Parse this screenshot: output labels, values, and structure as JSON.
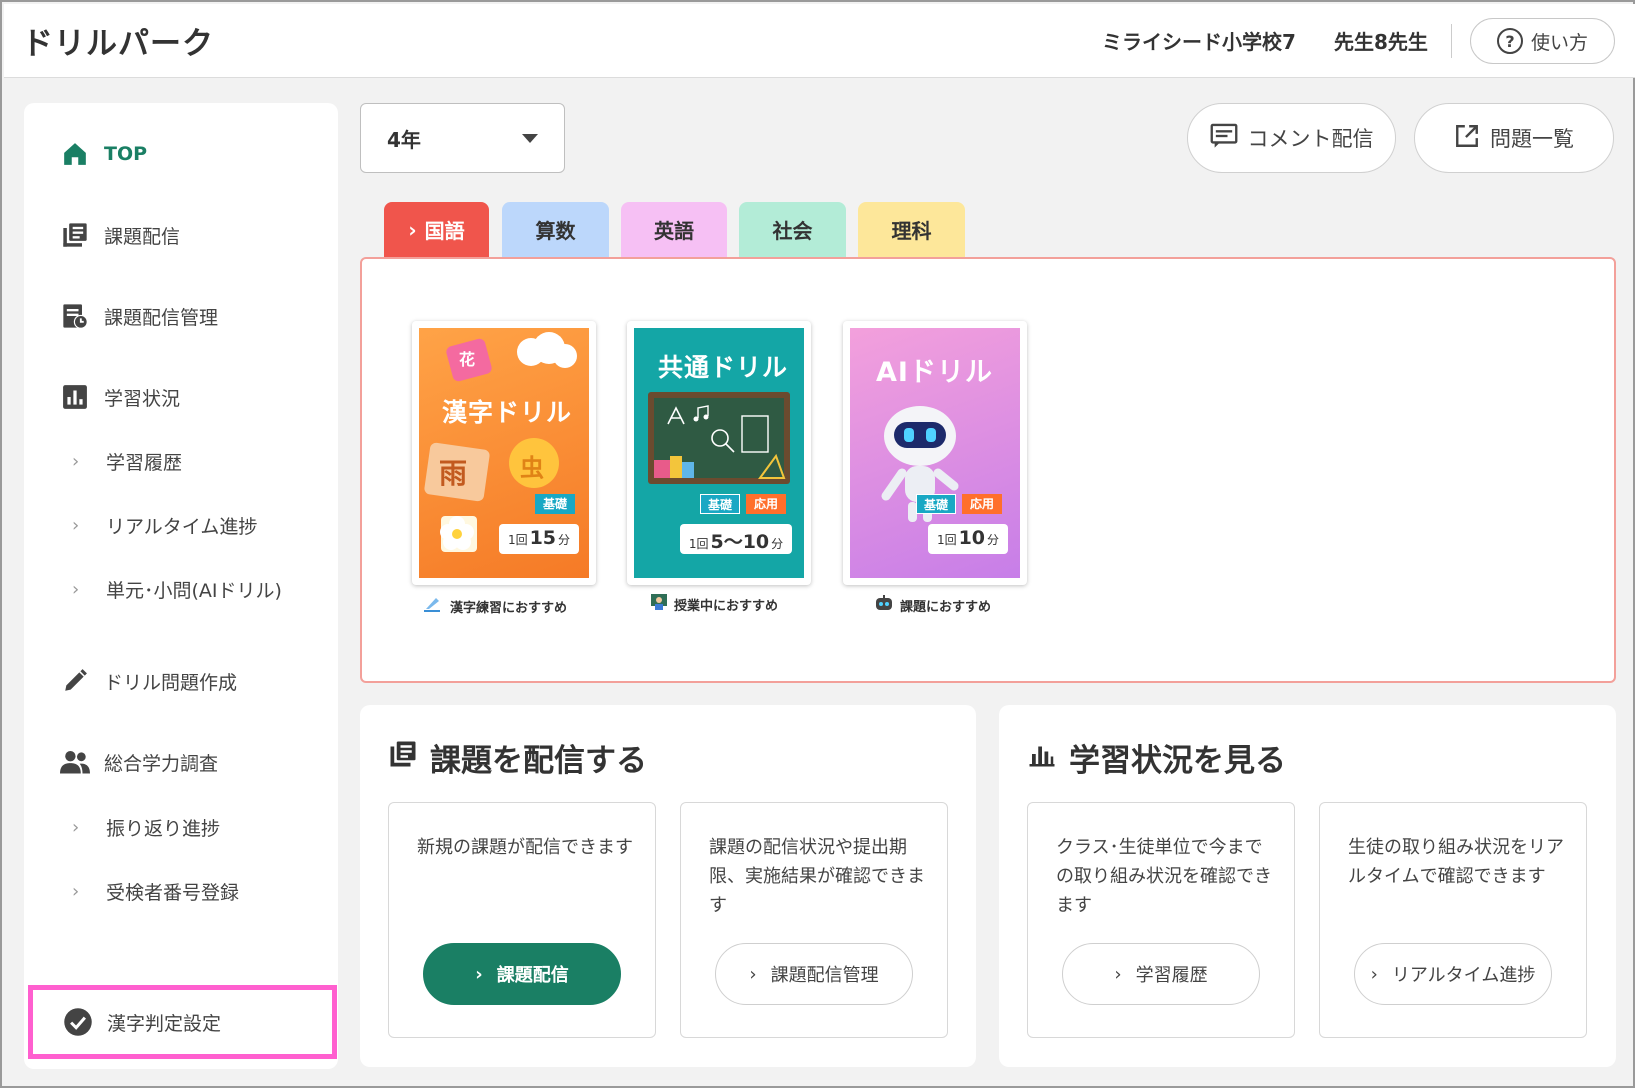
{
  "header": {
    "app_title": "ドリルパーク",
    "school": "ミライシード小学校7",
    "teacher": "先生8先生",
    "help_label": "使い方"
  },
  "sidebar": {
    "top": "TOP",
    "assign": "課題配信",
    "assign_manage": "課題配信管理",
    "study_status": "学習状況",
    "study_history": "学習履歴",
    "realtime": "リアルタイム進捗",
    "unit_ai": "単元･小問(AIドリル)",
    "drill_create": "ドリル問題作成",
    "survey": "総合学力調査",
    "review_progress": "振り返り進捗",
    "exam_number": "受検者番号登録",
    "kanji_setting": "漢字判定設定"
  },
  "toolbar": {
    "grade": "4年",
    "comment_btn": "コメント配信",
    "problem_list_btn": "問題一覧"
  },
  "tabs": [
    {
      "label": "国語",
      "color": "#f0554c",
      "active": true
    },
    {
      "label": "算数",
      "color": "#bcd7fb"
    },
    {
      "label": "英語",
      "color": "#f6c0f4"
    },
    {
      "label": "社会",
      "color": "#b3ecd7"
    },
    {
      "label": "理科",
      "color": "#fde79a"
    }
  ],
  "drills": [
    {
      "title": "漢字ドリル",
      "chars": [
        "花",
        "雨",
        "虫"
      ],
      "badges": [
        "基礎"
      ],
      "time_prefix": "1回",
      "time_value": "15",
      "time_unit": "分",
      "caption": "漢字練習におすすめ"
    },
    {
      "title": "共通ドリル",
      "badges": [
        "基礎",
        "応用"
      ],
      "time_prefix": "1回",
      "time_value": "5〜10",
      "time_unit": "分",
      "caption": "授業中におすすめ"
    },
    {
      "title": "AIドリル",
      "badges": [
        "基礎",
        "応用"
      ],
      "time_prefix": "1回",
      "time_value": "10",
      "time_unit": "分",
      "caption": "課題におすすめ"
    }
  ],
  "assign_panel": {
    "title": "課題を配信する",
    "cards": [
      {
        "desc": "新規の課題が配信できます",
        "button": "課題配信"
      },
      {
        "desc": "課題の配信状況や提出期限、実施結果が確認できます",
        "button": "課題配信管理"
      }
    ]
  },
  "status_panel": {
    "title": "学習状況を見る",
    "cards": [
      {
        "desc": "クラス･生徒単位で今までの取り組み状況を確認できます",
        "button": "学習履歴"
      },
      {
        "desc": "生徒の取り組み状況をリアルタイムで確認できます",
        "button": "リアルタイム進捗"
      }
    ]
  },
  "colors": {
    "accent": "#1a7f64",
    "highlight_border": "#ff5fcf",
    "panel_border": "#f3a09a"
  }
}
